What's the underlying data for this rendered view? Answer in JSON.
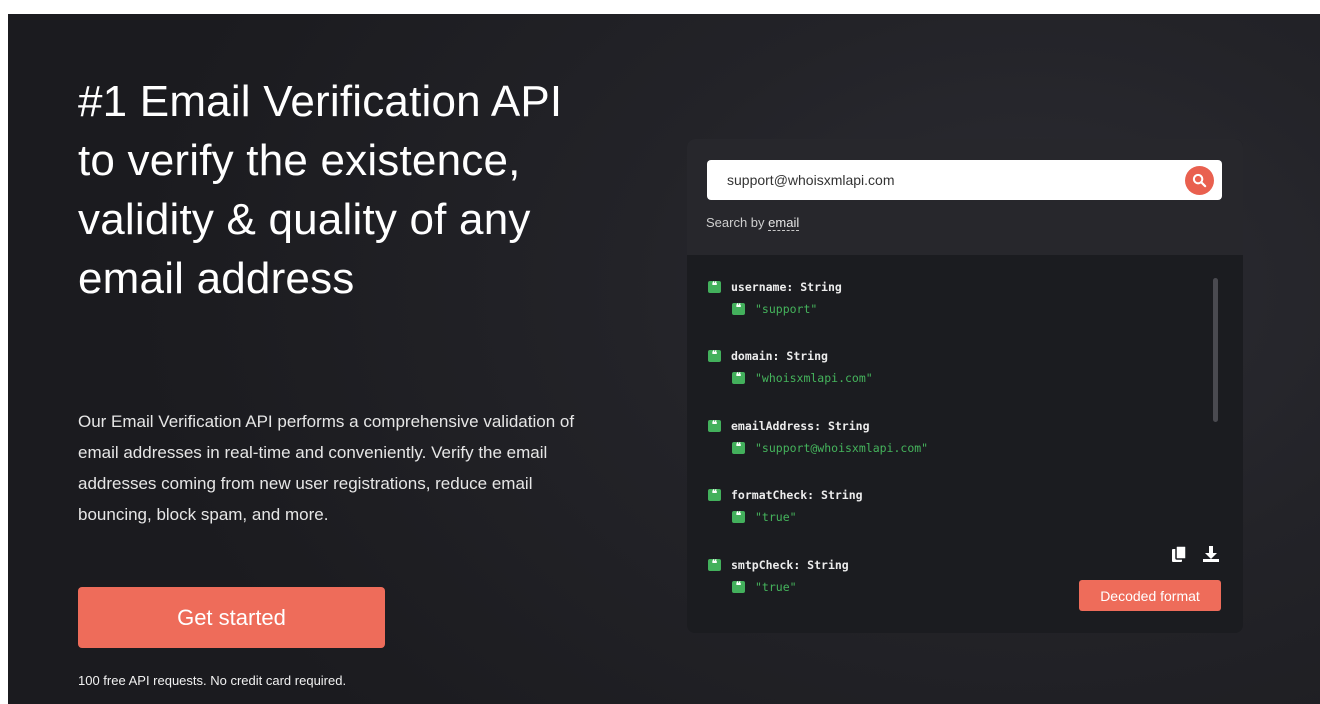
{
  "hero": {
    "headline": "#1 Email Verification API to verify the existence, validity & quality of any email address",
    "description": "Our Email Verification API performs a comprehensive validation of email addresses in real-time and conveniently. Verify the email addresses coming from new user registrations, reduce email bouncing, block spam, and more.",
    "cta_label": "Get started",
    "footnote": "100 free API requests. No credit card required."
  },
  "demo": {
    "search_value": "support@whoisxmlapi.com",
    "hint_prefix": "Search by ",
    "hint_link": "email",
    "results": [
      {
        "key": "username",
        "type": "String",
        "value": "\"support\""
      },
      {
        "key": "domain",
        "type": "String",
        "value": "\"whoisxmlapi.com\""
      },
      {
        "key": "emailAddress",
        "type": "String",
        "value": "\"support@whoisxmlapi.com\""
      },
      {
        "key": "formatCheck",
        "type": "String",
        "value": "\"true\""
      },
      {
        "key": "smtpCheck",
        "type": "String",
        "value": "\"true\""
      }
    ],
    "decoded_label": "Decoded format",
    "quote_glyph": "❝"
  },
  "colors": {
    "accent": "#ee6c5a",
    "value_green": "#45b45c",
    "background": "#1b1b1f"
  },
  "icons": {
    "search": "search-icon",
    "copy": "copy-icon",
    "download": "download-icon",
    "quote": "quote-icon"
  }
}
